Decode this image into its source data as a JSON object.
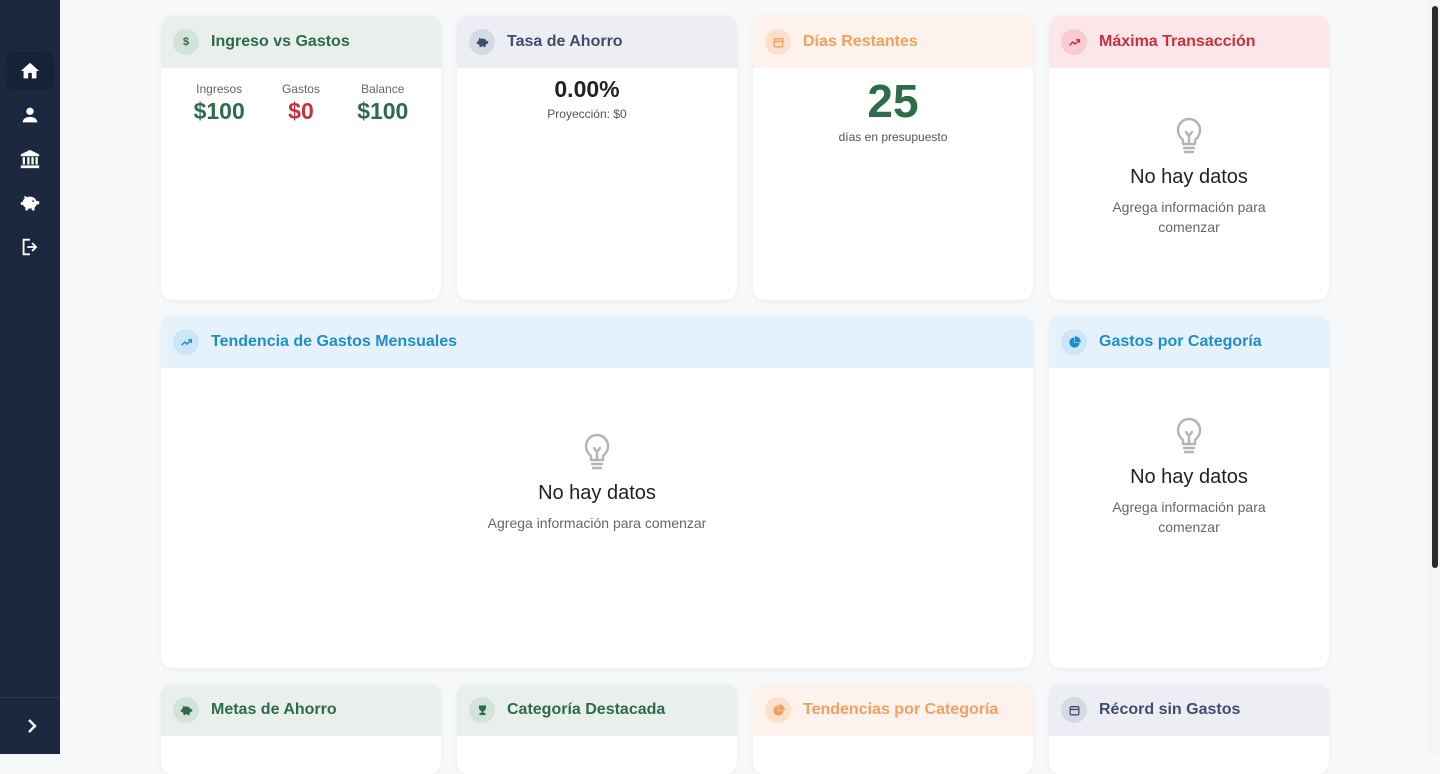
{
  "sidebar": {
    "items": [
      {
        "name": "home",
        "icon": "home-icon"
      },
      {
        "name": "user",
        "icon": "user-icon"
      },
      {
        "name": "bank",
        "icon": "bank-icon"
      },
      {
        "name": "savings",
        "icon": "piggy-bank-icon"
      },
      {
        "name": "logout",
        "icon": "logout-icon"
      }
    ],
    "expand_icon": "chevron-right-icon"
  },
  "cards": {
    "income_expense": {
      "title": "Ingreso vs Gastos",
      "badge": "$",
      "stats": [
        {
          "label": "Ingresos",
          "value": "$100"
        },
        {
          "label": "Gastos",
          "value": "$0"
        },
        {
          "label": "Balance",
          "value": "$100"
        }
      ]
    },
    "savings_rate": {
      "title": "Tasa de Ahorro",
      "value": "0.00%",
      "note": "Proyección: $0"
    },
    "days_left": {
      "title": "Días Restantes",
      "value": "25",
      "note": "días en presupuesto"
    },
    "max_transaction": {
      "title": "Máxima Transacción",
      "empty_title": "No hay datos",
      "empty_sub": "Agrega información para comenzar"
    },
    "monthly_trend": {
      "title": "Tendencia de Gastos Mensuales",
      "empty_title": "No hay datos",
      "empty_sub": "Agrega información para comenzar"
    },
    "by_category": {
      "title": "Gastos por Categoría",
      "empty_title": "No hay datos",
      "empty_sub": "Agrega información para comenzar"
    },
    "savings_goals": {
      "title": "Metas de Ahorro"
    },
    "top_category": {
      "title": "Categoría Destacada"
    },
    "category_trends": {
      "title": "Tendencias por Categoría"
    },
    "no_spend_record": {
      "title": "Récord sin Gastos"
    }
  },
  "colors": {
    "sidebar": "#1c2840",
    "green": "#2e6b4a",
    "red": "#c8303e",
    "orange": "#f0a060",
    "blue": "#1f8ec8",
    "slate": "#3e4e6b"
  }
}
